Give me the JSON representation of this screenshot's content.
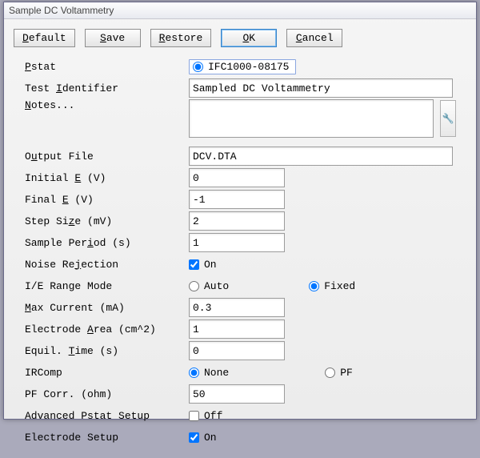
{
  "window": {
    "title": "Sample DC Voltammetry"
  },
  "buttons": {
    "default_pre": "D",
    "default_rest": "efault",
    "save_pre": "S",
    "save_rest": "ave",
    "restore_pre": "R",
    "restore_rest": "estore",
    "ok_pre": "O",
    "ok_rest": "K",
    "cancel_pre": "C",
    "cancel_rest": "ancel"
  },
  "labels": {
    "pstat_pre": "P",
    "pstat_rest": "stat",
    "testid": "Test ",
    "testid_u": "I",
    "testid_rest": "dentifier",
    "notes_u": "N",
    "notes_rest": "otes...",
    "output": "O",
    "output_u": "u",
    "output_rest": "tput File",
    "initE": "Initial ",
    "initE_u": "E",
    "initE_rest": " (V)",
    "finE": "Final ",
    "finE_u": "E",
    "finE_rest": " (V)",
    "step": "Step Si",
    "step_u": "z",
    "step_rest": "e (mV)",
    "sper": "Sample Per",
    "sper_u": "i",
    "sper_rest": "od (s)",
    "noise": "Noise Re",
    "noise_u": "j",
    "noise_rest": "ection",
    "ier": "I/E Range Mode",
    "maxc_u": "M",
    "maxc_rest": "ax Current (mA)",
    "area": "Electrode ",
    "area_u": "A",
    "area_rest": "rea (cm^2)",
    "eqt": "Equil. ",
    "eqt_u": "T",
    "eqt_rest": "ime (s)",
    "ircomp": "IRComp",
    "pfc": "PF Corr. (ohm)",
    "adv": "Advanced Pstat Setup",
    "esu": "Electrode Setup"
  },
  "values": {
    "pstat": "IFC1000-08175",
    "test_identifier": "Sampled DC Voltammetry",
    "notes": "",
    "output_file": "DCV.DTA",
    "initial_e": "0",
    "final_e": "-1",
    "step_size": "2",
    "sample_period": "1",
    "noise_on": true,
    "noise_label": "On",
    "ie_mode": "Fixed",
    "ie_auto": "Auto",
    "ie_fixed": "Fixed",
    "max_current": "0.3",
    "electrode_area": "1",
    "equil_time": "0",
    "ircomp": "None",
    "ircomp_none": "None",
    "ircomp_pf": "PF",
    "pf_corr": "50",
    "adv_on": false,
    "adv_label": "Off",
    "esu_on": true,
    "esu_label": "On"
  }
}
